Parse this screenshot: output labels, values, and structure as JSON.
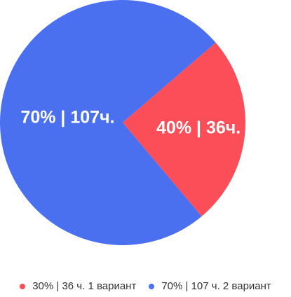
{
  "chart_data": {
    "type": "pie",
    "title": "",
    "slices": [
      {
        "label": "40% | 36ч.",
        "value": 36,
        "percent_label": 40,
        "color": "#fc4e58"
      },
      {
        "label": "70% | 107ч.",
        "value": 107,
        "percent_label": 70,
        "color": "#4a70f0"
      }
    ],
    "start_angle_deg": -40.7,
    "legend_position": "bottom",
    "legend": [
      {
        "text": "30% | 36 ч. 1 вариант",
        "color": "#fc4e58"
      },
      {
        "text": "70% | 107 ч. 2 вариант",
        "color": "#4a70f0"
      }
    ]
  }
}
